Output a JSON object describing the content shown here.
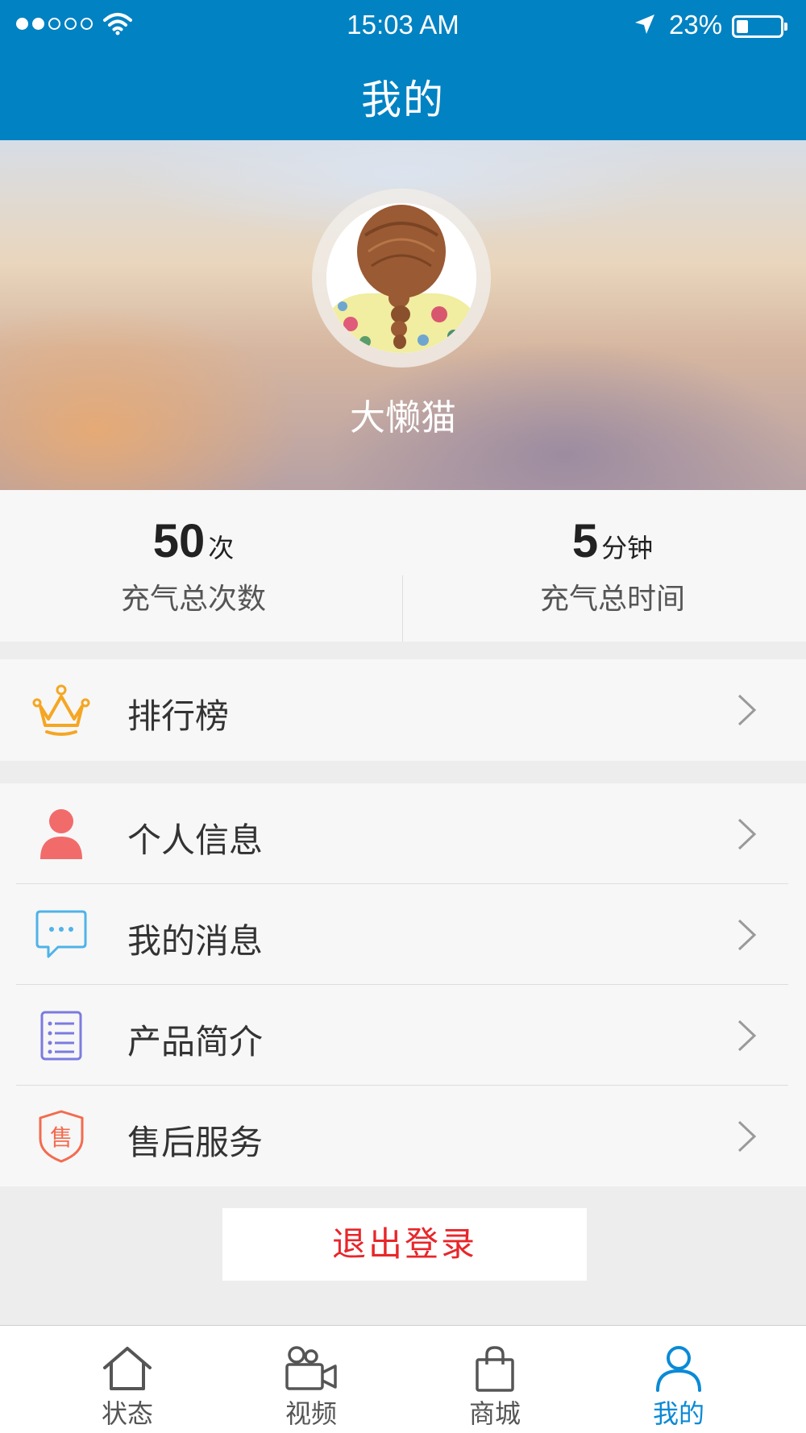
{
  "status_bar": {
    "time": "15:03 AM",
    "battery_percent": "23%",
    "battery_level": 0.23,
    "signal_bars_filled": 2,
    "signal_bars_total": 5
  },
  "header": {
    "title": "我的",
    "background_color": "#0082c3"
  },
  "profile": {
    "username": "大懒猫"
  },
  "stats": {
    "inflation_count": {
      "value": "50",
      "unit": "次",
      "label": "充气总次数"
    },
    "inflation_time": {
      "value": "5",
      "unit": "分钟",
      "label": "充气总时间"
    }
  },
  "menu": {
    "ranking": {
      "label": "排行榜",
      "icon": "crown-icon",
      "icon_color": "#f5a623"
    },
    "items": [
      {
        "label": "个人信息",
        "icon": "person-icon",
        "icon_color": "#f26b6b"
      },
      {
        "label": "我的消息",
        "icon": "message-icon",
        "icon_color": "#4fb3e8"
      },
      {
        "label": "产品简介",
        "icon": "document-list-icon",
        "icon_color": "#7b7be0"
      },
      {
        "label": "售后服务",
        "icon": "shield-service-icon",
        "icon_color": "#f36b4f",
        "icon_text": "售"
      }
    ]
  },
  "logout": {
    "label": "退出登录",
    "color": "#e8262a"
  },
  "tabbar": {
    "tabs": [
      {
        "label": "状态",
        "icon": "home-icon",
        "active": false
      },
      {
        "label": "视频",
        "icon": "video-camera-icon",
        "active": false
      },
      {
        "label": "商城",
        "icon": "shopping-bag-icon",
        "active": false
      },
      {
        "label": "我的",
        "icon": "user-icon",
        "active": true
      }
    ],
    "active_color": "#0a8ad6"
  }
}
